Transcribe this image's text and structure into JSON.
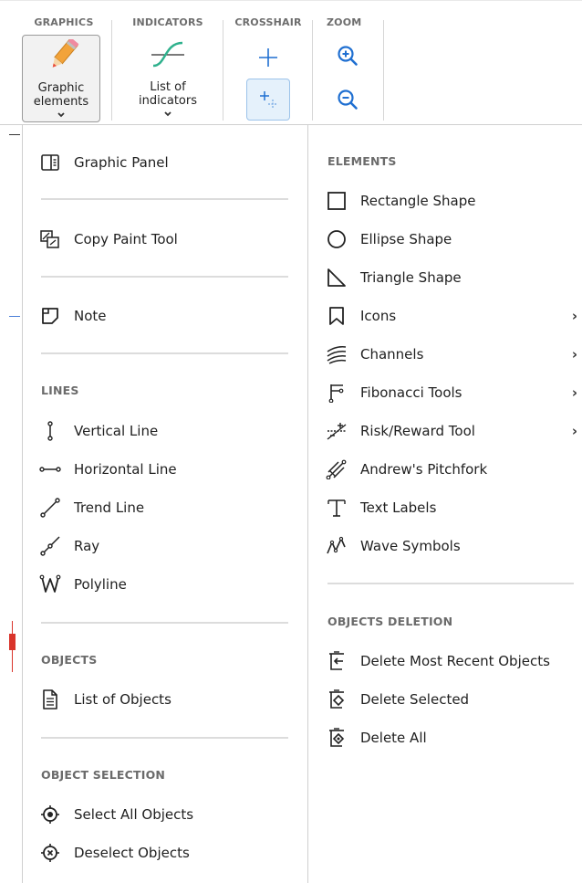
{
  "ribbon": {
    "graphics": {
      "title": "GRAPHICS",
      "button_line1": "Graphic",
      "button_line2": "elements"
    },
    "indicators": {
      "title": "INDICATORS",
      "button_line1": "List of",
      "button_line2": "indicators"
    },
    "crosshair": {
      "title": "CROSSHAIR"
    },
    "zoom": {
      "title": "ZOOM"
    }
  },
  "menu": {
    "left": {
      "graphic_panel": "Graphic Panel",
      "copy_paint_tool": "Copy Paint Tool",
      "note": "Note",
      "lines_header": "LINES",
      "lines": [
        "Vertical Line",
        "Horizontal Line",
        "Trend Line",
        "Ray",
        "Polyline"
      ],
      "objects_header": "OBJECTS",
      "list_of_objects": "List of Objects",
      "selection_header": "OBJECT SELECTION",
      "select_all": "Select All Objects",
      "deselect": "Deselect Objects"
    },
    "right": {
      "elements_header": "ELEMENTS",
      "elements": [
        "Rectangle Shape",
        "Ellipse Shape",
        "Triangle Shape",
        "Icons",
        "Channels",
        "Fibonacci Tools",
        "Risk/Reward Tool",
        "Andrew's Pitchfork",
        "Text Labels",
        "Wave Symbols"
      ],
      "submenu_arrow": "›",
      "deletion_header": "OBJECTS DELETION",
      "deletion": [
        "Delete Most Recent Objects",
        "Delete Selected",
        "Delete All"
      ]
    }
  },
  "colors": {
    "accent": "#1f6fd1",
    "indicator_green": "#2fb18d",
    "pencil": "#f2a33a",
    "pencil_tip": "#e94e3c",
    "selected_bg": "#e5f1fb",
    "chart_red": "#d9342b"
  }
}
